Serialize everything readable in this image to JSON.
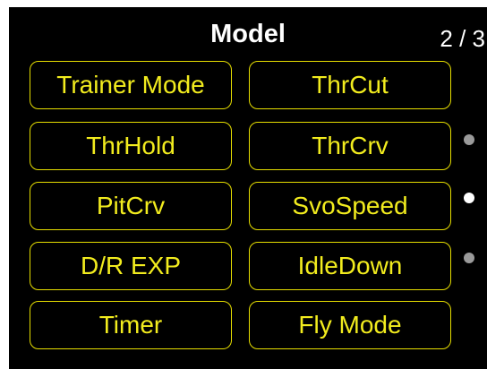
{
  "header": {
    "title": "Model",
    "page_indicator": "2 / 3"
  },
  "menu": {
    "left": [
      {
        "label": "Trainer Mode"
      },
      {
        "label": "ThrHold"
      },
      {
        "label": "PitCrv"
      },
      {
        "label": "D/R EXP"
      },
      {
        "label": "Timer"
      }
    ],
    "right": [
      {
        "label": "ThrCut"
      },
      {
        "label": "ThrCrv"
      },
      {
        "label": "SvoSpeed"
      },
      {
        "label": "IdleDown"
      },
      {
        "label": "Fly Mode"
      }
    ]
  },
  "pager": {
    "active_index": 1,
    "dots": 3
  },
  "colors": {
    "background": "#000000",
    "button_border": "#e6de00",
    "button_text": "#f2ec1e",
    "title_text": "#ffffff",
    "dot_inactive": "#9a9a9a",
    "dot_active": "#ffffff"
  }
}
